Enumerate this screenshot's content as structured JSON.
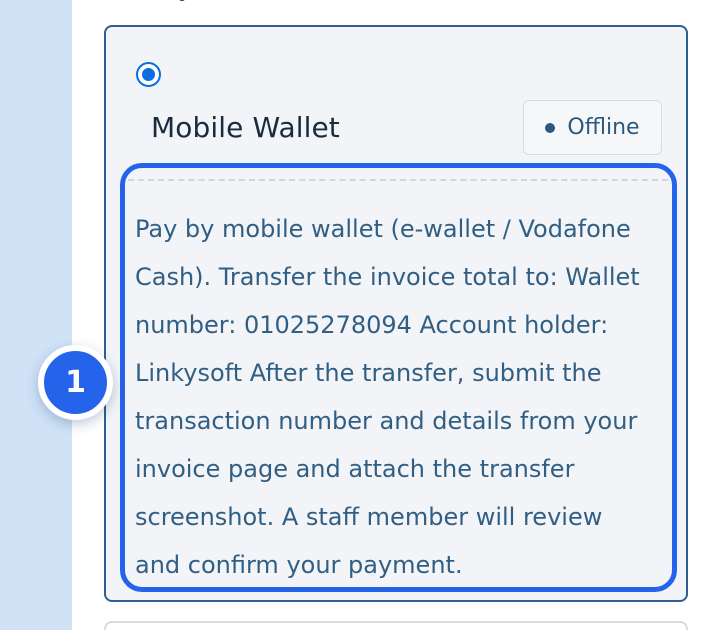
{
  "payment_option": {
    "radio_selected": true,
    "title": "Mobile Wallet",
    "status_label": "Offline",
    "description": "Pay by mobile wallet (e-wallet / Vodafone Cash). Transfer the invoice total to: Wallet number: 01025278094 Account holder: Linkysoft After the transfer, submit the transaction number and details from your invoice page and attach the transfer screenshot. A staff member will review and confirm your payment."
  },
  "annotation": {
    "number": "1"
  },
  "colors": {
    "accent": "#2563eb",
    "radio_blue": "#0b6ee0",
    "card_border": "#2d5f91",
    "text_primary": "#1a2a3f",
    "text_secondary": "#315f84",
    "sidebar": "#cfe2f6"
  }
}
